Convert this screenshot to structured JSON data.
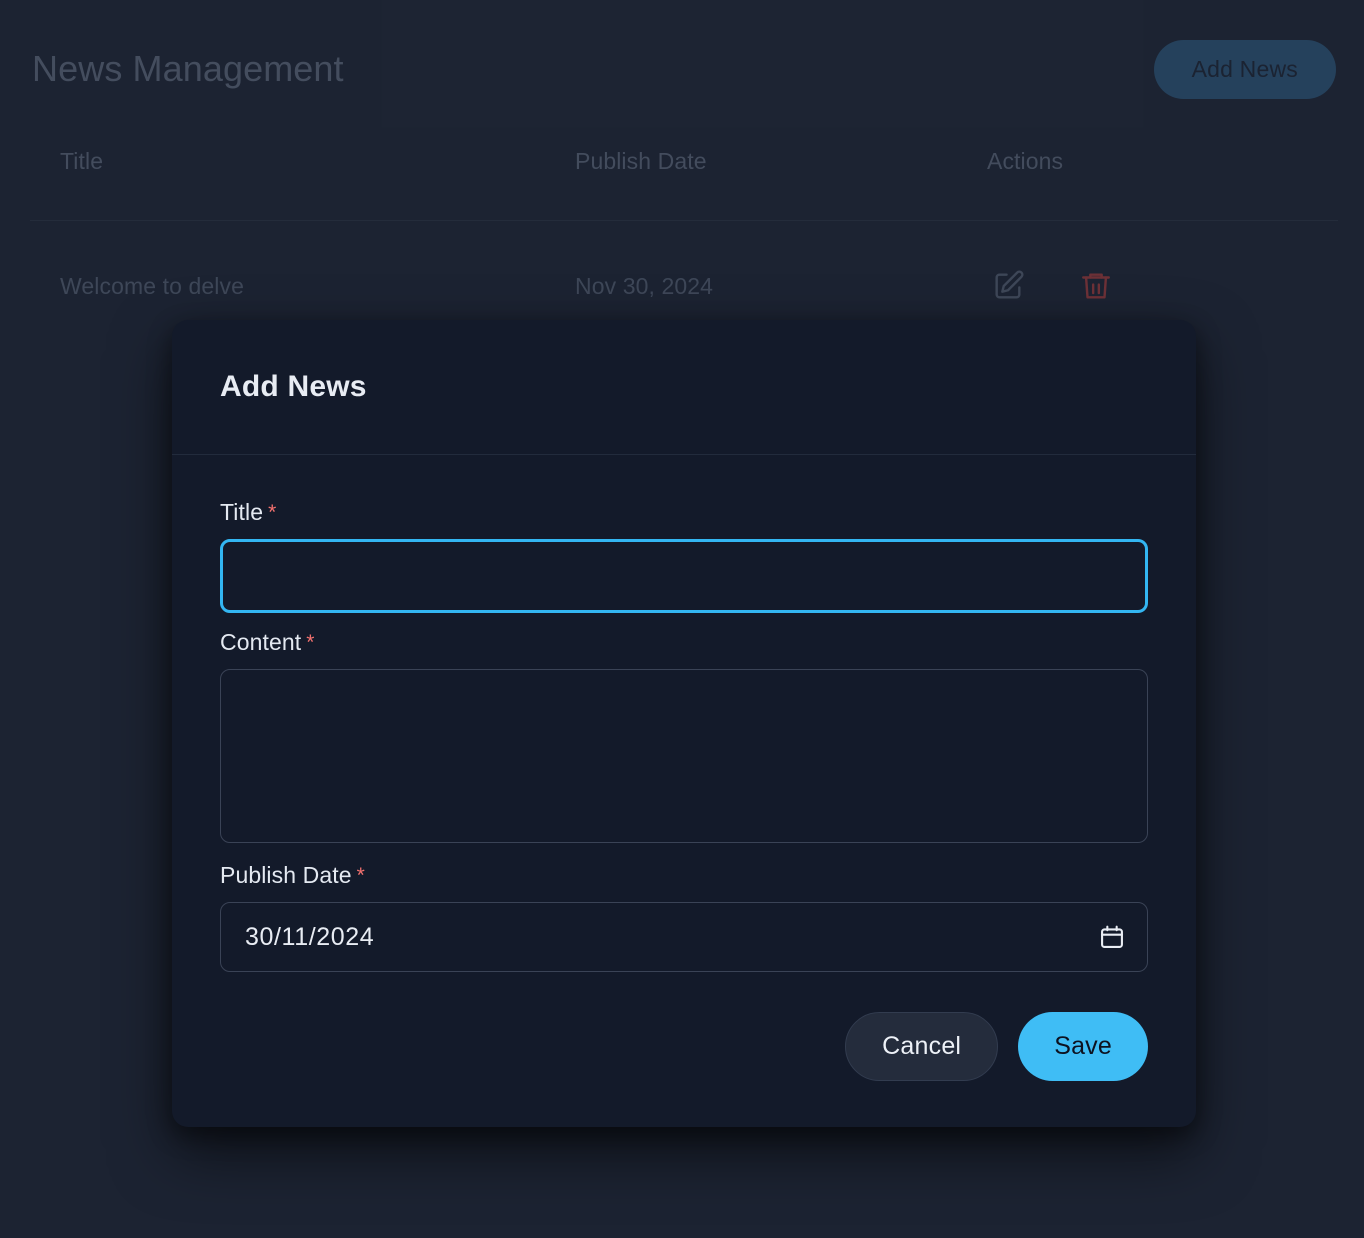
{
  "page": {
    "title": "News Management",
    "add_button_label": "Add News",
    "table": {
      "columns": [
        "Title",
        "Publish Date",
        "Actions"
      ],
      "rows": [
        {
          "title": "Welcome to delve",
          "publish_date": "Nov 30, 2024",
          "actions": [
            "edit-icon",
            "delete-icon"
          ]
        }
      ]
    }
  },
  "modal": {
    "title": "Add News",
    "fields": {
      "title": {
        "label": "Title",
        "required_marker": "*",
        "value": "",
        "placeholder": ""
      },
      "content": {
        "label": "Content",
        "required_marker": "*",
        "value": "",
        "placeholder": ""
      },
      "publish_date": {
        "label": "Publish Date",
        "required_marker": "*",
        "value": "30/11/2024",
        "icon": "calendar-icon"
      }
    },
    "buttons": {
      "cancel": "Cancel",
      "save": "Save"
    }
  },
  "colors": {
    "page_background": "#222a3a",
    "modal_background": "#131a2a",
    "accent": "#3fbdf5",
    "focus_border": "#33b6f2",
    "required_asterisk": "#f2716f",
    "delete_icon": "#8a3b40",
    "muted_text": "#545e71",
    "primary_text": "#e8ecf3"
  }
}
